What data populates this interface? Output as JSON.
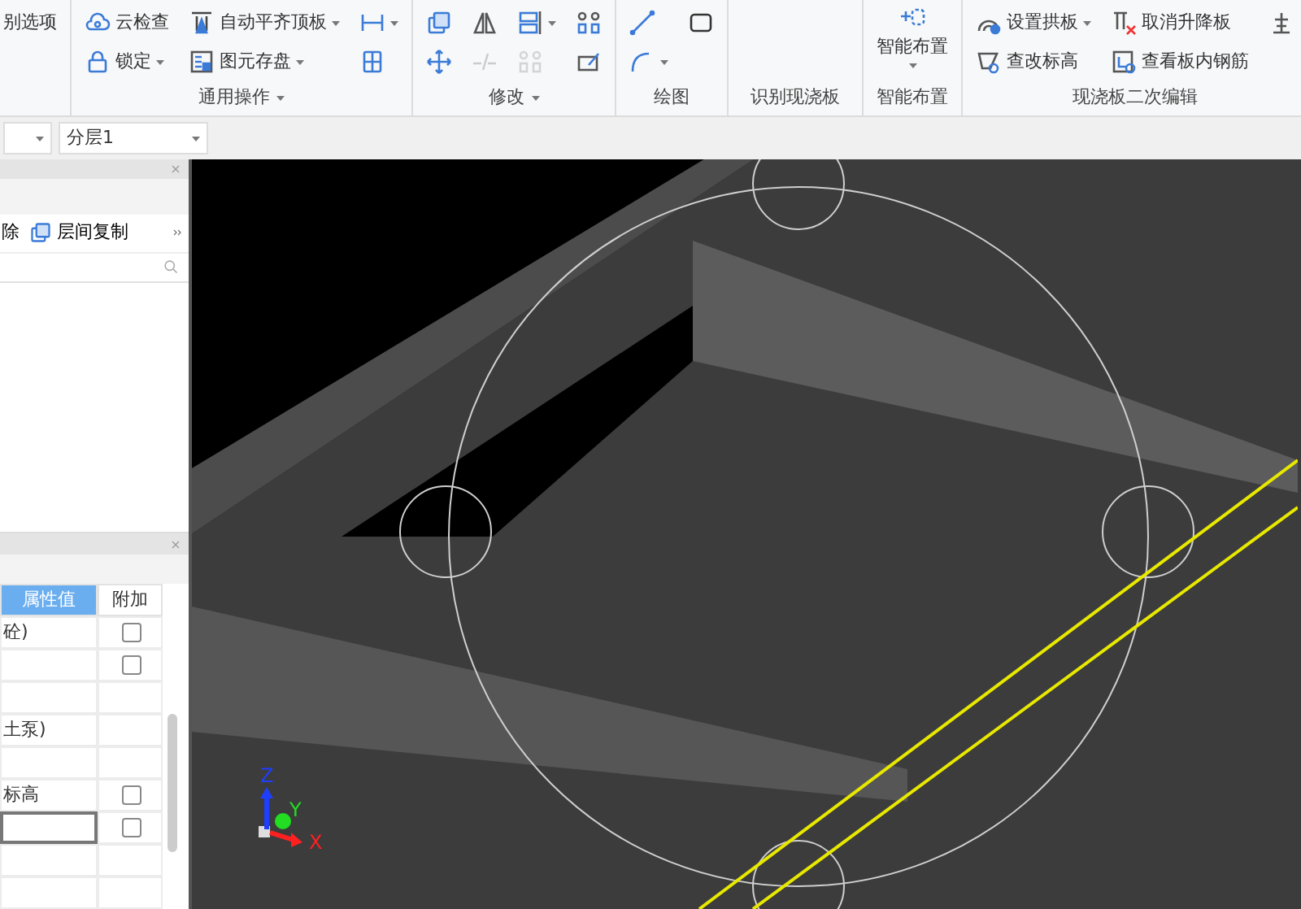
{
  "ribbon": {
    "groups": [
      {
        "columns": [
          [
            {
              "label": "别选项",
              "dropdown": false,
              "disabled": false
            }
          ]
        ]
      },
      {
        "title": "通用操作",
        "title_dropdown": true,
        "columns": [
          [
            {
              "label": "云检查",
              "dropdown": false,
              "disabled": false
            },
            {
              "label": "锁定",
              "dropdown": true,
              "disabled": false
            }
          ],
          [
            {
              "label": "自动平齐顶板",
              "dropdown": true,
              "disabled": false
            },
            {
              "label": "图元存盘",
              "dropdown": true,
              "disabled": false
            }
          ],
          [
            {
              "dropdown": true,
              "disabled": false
            },
            {
              "dropdown": false,
              "disabled": false
            }
          ]
        ]
      },
      {
        "title": "修改",
        "title_dropdown": true,
        "columns": [
          [
            {
              "dropdown": false,
              "disabled": false
            },
            {
              "dropdown": false,
              "disabled": false
            }
          ],
          [
            {
              "dropdown": false,
              "disabled": false
            },
            {
              "dropdown": false,
              "disabled": true
            }
          ],
          [
            {
              "dropdown": true,
              "disabled": false
            },
            {
              "dropdown": false,
              "disabled": true
            }
          ],
          [
            {
              "dropdown": false,
              "disabled": false
            },
            {
              "dropdown": false,
              "disabled": false
            }
          ]
        ]
      },
      {
        "title": "绘图",
        "title_dropdown": false,
        "columns": [
          [
            {
              "dropdown": false,
              "disabled": false
            },
            {
              "dropdown": true,
              "disabled": false
            }
          ],
          [
            {
              "dropdown": false,
              "disabled": false
            }
          ]
        ]
      },
      {
        "title": "识别现浇板",
        "title_dropdown": false
      },
      {
        "title": "智能布置",
        "title_dropdown": false,
        "large": {
          "label": "智能布置",
          "dropdown": true
        }
      },
      {
        "title": "现浇板二次编辑",
        "title_dropdown": false,
        "columns": [
          [
            {
              "label": "设置拱板",
              "dropdown": true,
              "disabled": false
            },
            {
              "label": "查改标高",
              "dropdown": false,
              "disabled": false
            }
          ],
          [
            {
              "label": "取消升降板",
              "dropdown": false,
              "disabled": false
            },
            {
              "label": "查看板内钢筋",
              "dropdown": false,
              "disabled": false
            }
          ],
          [
            {
              "dropdown": false,
              "disabled": false
            }
          ]
        ]
      }
    ]
  },
  "layer_bar": {
    "layer_dropdown": {
      "value": "分层1"
    }
  },
  "component_panel": {
    "toolbar": [
      {
        "label": "除"
      },
      {
        "label": "层间复制"
      }
    ]
  },
  "property_panel": {
    "columns": [
      {
        "label": "属性值",
        "selected": true
      },
      {
        "label": "附加",
        "selected": false
      }
    ],
    "rows": [
      {
        "value": "砼)",
        "checkbox": true,
        "checked": false,
        "selected": false
      },
      {
        "checkbox": true,
        "checked": false,
        "selected": false
      },
      {
        "checkbox": false,
        "selected": false
      },
      {
        "value": "土泵)",
        "checkbox": false,
        "selected": false
      },
      {
        "checkbox": false,
        "selected": false
      },
      {
        "value": "标高",
        "checkbox": true,
        "checked": false,
        "selected": false
      },
      {
        "checkbox": true,
        "checked": false,
        "selected": true
      },
      {
        "checkbox": false,
        "selected": false
      },
      {
        "checkbox": false,
        "selected": false
      }
    ]
  },
  "viewport": {
    "axes": [
      {
        "label": "Z",
        "color": "#1f3fff"
      },
      {
        "label": "Y",
        "color": "#22dd22"
      },
      {
        "label": "X",
        "color": "#ff2020"
      }
    ]
  }
}
